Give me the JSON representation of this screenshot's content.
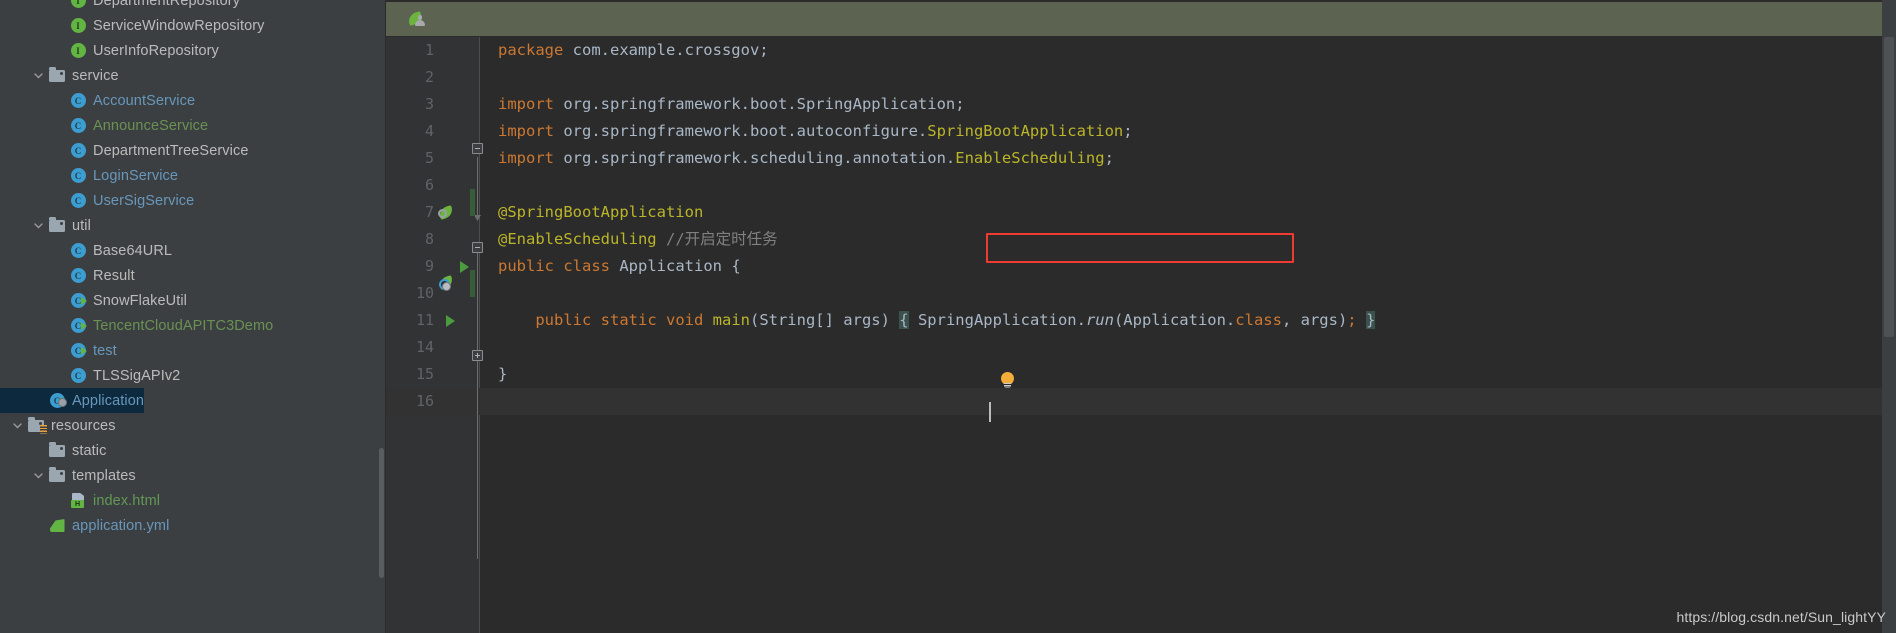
{
  "sidebar": {
    "scrollbar": {
      "name": "project-tree-scrollbar"
    },
    "items": [
      {
        "label": "DepartmentRepository",
        "icon": "interface-icon",
        "indent": 3,
        "chevron": "none",
        "color": "c-default",
        "clipped": true
      },
      {
        "label": "ServiceWindowRepository",
        "icon": "interface-icon",
        "indent": 3,
        "chevron": "none",
        "color": "c-default"
      },
      {
        "label": "UserInfoRepository",
        "icon": "interface-icon",
        "indent": 3,
        "chevron": "none",
        "color": "c-default"
      },
      {
        "label": "service",
        "icon": "folder-icon",
        "indent": 2,
        "chevron": "down",
        "color": "c-default"
      },
      {
        "label": "AccountService",
        "icon": "class-icon",
        "indent": 3,
        "chevron": "none",
        "color": "c-blue"
      },
      {
        "label": "AnnounceService",
        "icon": "class-icon",
        "indent": 3,
        "chevron": "none",
        "color": "c-green"
      },
      {
        "label": "DepartmentTreeService",
        "icon": "class-icon",
        "indent": 3,
        "chevron": "none",
        "color": "c-default"
      },
      {
        "label": "LoginService",
        "icon": "class-icon",
        "indent": 3,
        "chevron": "none",
        "color": "c-blue"
      },
      {
        "label": "UserSigService",
        "icon": "class-icon",
        "indent": 3,
        "chevron": "none",
        "color": "c-blue"
      },
      {
        "label": "util",
        "icon": "folder-icon",
        "indent": 2,
        "chevron": "down",
        "color": "c-default"
      },
      {
        "label": "Base64URL",
        "icon": "class-icon",
        "indent": 3,
        "chevron": "none",
        "color": "c-default"
      },
      {
        "label": "Result",
        "icon": "class-icon",
        "indent": 3,
        "chevron": "none",
        "color": "c-default"
      },
      {
        "label": "SnowFlakeUtil",
        "icon": "runnable-class-icon",
        "indent": 3,
        "chevron": "none",
        "color": "c-default"
      },
      {
        "label": "TencentCloudAPITC3Demo",
        "icon": "runnable-class-icon",
        "indent": 3,
        "chevron": "none",
        "color": "c-green"
      },
      {
        "label": "test",
        "icon": "runnable-class-icon",
        "indent": 3,
        "chevron": "none",
        "color": "c-blue"
      },
      {
        "label": "TLSSigAPIv2",
        "icon": "class-icon",
        "indent": 3,
        "chevron": "none",
        "color": "c-default"
      },
      {
        "label": "Application",
        "icon": "spring-boot-class-icon",
        "indent": 2,
        "chevron": "none",
        "color": "c-blue",
        "selected": true
      },
      {
        "label": "resources",
        "icon": "resources-folder-icon",
        "indent": 1,
        "chevron": "down",
        "color": "c-default"
      },
      {
        "label": "static",
        "icon": "folder-plain-icon",
        "indent": 2,
        "chevron": "none",
        "color": "c-default"
      },
      {
        "label": "templates",
        "icon": "folder-plain-icon",
        "indent": 2,
        "chevron": "down",
        "color": "c-default"
      },
      {
        "label": "index.html",
        "icon": "html-file-icon",
        "indent": 3,
        "chevron": "none",
        "color": "c-greenf"
      },
      {
        "label": "application.yml",
        "icon": "yml-file-icon",
        "indent": 2,
        "chevron": "none",
        "color": "c-blue",
        "clipped": true
      }
    ]
  },
  "editor": {
    "tab_icon": "spring-boot-tab-icon",
    "scrollbar": {
      "name": "editor-scrollbar"
    },
    "annotation": {
      "name": "red-highlight-box",
      "color": "#ef3b32",
      "target_line": "8"
    },
    "lines": [
      {
        "num": "1",
        "tokens": [
          {
            "t": "package ",
            "c": "kw"
          },
          {
            "t": "com.example.crossgov;",
            "c": "ident"
          }
        ]
      },
      {
        "num": "2",
        "tokens": []
      },
      {
        "num": "3",
        "tokens": [
          {
            "t": "import ",
            "c": "kw"
          },
          {
            "t": "org.springframework.boot.SpringApplication;",
            "c": "ident"
          }
        ]
      },
      {
        "num": "4",
        "tokens": [
          {
            "t": "import ",
            "c": "kw"
          },
          {
            "t": "org.springframework.boot.autoconfigure.",
            "c": "ident"
          },
          {
            "t": "SpringBootApplication",
            "c": "cls"
          },
          {
            "t": ";",
            "c": "ident"
          }
        ]
      },
      {
        "num": "5",
        "tokens": [
          {
            "t": "import ",
            "c": "kw"
          },
          {
            "t": "org.springframework.scheduling.annotation.",
            "c": "ident"
          },
          {
            "t": "EnableScheduling",
            "c": "cls"
          },
          {
            "t": ";",
            "c": "ident"
          }
        ]
      },
      {
        "num": "6",
        "tokens": []
      },
      {
        "num": "7",
        "tokens": [
          {
            "t": "@SpringBootApplication",
            "c": "anno"
          }
        ]
      },
      {
        "num": "8",
        "tokens": [
          {
            "t": "@EnableScheduling",
            "c": "anno"
          },
          {
            "t": " ",
            "c": "ident"
          },
          {
            "t": "//开启定时任务",
            "c": "cmt"
          }
        ]
      },
      {
        "num": "9",
        "tokens": [
          {
            "t": "public ",
            "c": "kw"
          },
          {
            "t": "class ",
            "c": "kw"
          },
          {
            "t": "Application",
            "c": "ident"
          },
          {
            "t": " {",
            "c": "ident"
          }
        ]
      },
      {
        "num": "10",
        "tokens": []
      },
      {
        "num": "11",
        "tokens": [
          {
            "t": "    ",
            "c": "ident"
          },
          {
            "t": "public ",
            "c": "kw"
          },
          {
            "t": "static ",
            "c": "kw"
          },
          {
            "t": "void ",
            "c": "kw"
          },
          {
            "t": "main",
            "c": "anno"
          },
          {
            "t": "(String[] args) ",
            "c": "ident"
          },
          {
            "t": "{",
            "c": "brace-hl"
          },
          {
            "t": " SpringApplication.",
            "c": "ident"
          },
          {
            "t": "run",
            "c": "ital"
          },
          {
            "t": "(Application.",
            "c": "ident"
          },
          {
            "t": "class",
            "c": "kw"
          },
          {
            "t": ", args)",
            "c": "ident"
          },
          {
            "t": ";",
            "c": "kw"
          },
          {
            "t": " ",
            "c": "ident"
          },
          {
            "t": "}",
            "c": "brace-hl"
          }
        ]
      },
      {
        "num": "14",
        "tokens": []
      },
      {
        "num": "15",
        "tokens": [
          {
            "t": "}",
            "c": "ident"
          }
        ]
      },
      {
        "num": "16",
        "tokens": []
      }
    ],
    "gutter_icons": [
      {
        "line": "7",
        "icon": "spring-bean-gutter-icon"
      },
      {
        "line": "9",
        "icon": "spring-bean-gutter-icon"
      },
      {
        "line": "9",
        "icon": "run-class-gutter-icon"
      },
      {
        "line": "11",
        "icon": "run-method-gutter-icon"
      }
    ],
    "intention_bulb": {
      "line": "15",
      "icon": "intention-bulb-icon"
    }
  },
  "watermark": {
    "text": "https://blog.csdn.net/Sun_lightYY"
  }
}
